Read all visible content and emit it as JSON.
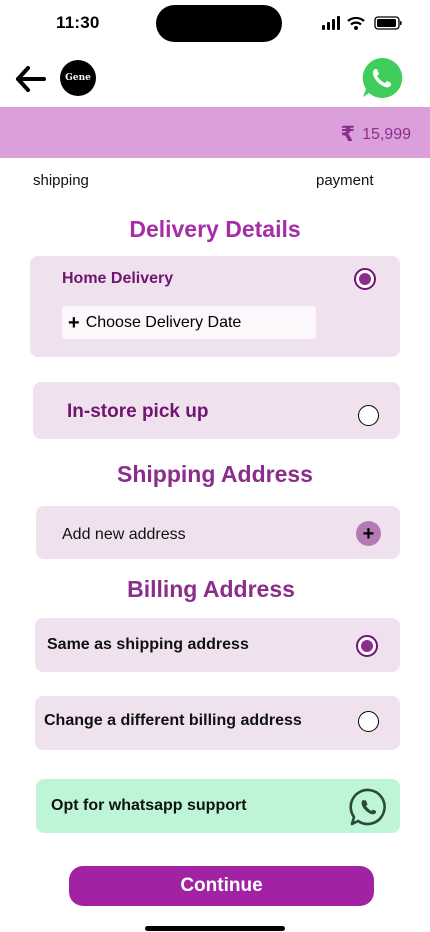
{
  "status_bar": {
    "time": "11:30"
  },
  "header": {
    "logo_text": "Gene"
  },
  "price_bar": {
    "currency_symbol": "₹",
    "amount": "15,999",
    "color": "#dba0dc"
  },
  "steps": {
    "shipping": "shipping",
    "payment": "payment"
  },
  "delivery": {
    "title": "Delivery Details",
    "home_delivery": {
      "label": "Home Delivery",
      "selected": true,
      "date_button": "Choose Delivery Date"
    },
    "in_store": {
      "label": "In-store pick up",
      "selected": false
    }
  },
  "shipping_address": {
    "title": "Shipping Address",
    "add_new": "Add new address"
  },
  "billing_address": {
    "title": "Billing Address",
    "same": {
      "label": "Same as shipping address",
      "selected": true
    },
    "different": {
      "label": "Change a different billing address",
      "selected": false
    }
  },
  "whatsapp_support": {
    "label": "Opt for whatsapp support",
    "color": "#bdf5d6"
  },
  "continue_button": {
    "label": "Continue",
    "color": "#a222a4"
  },
  "icons": [
    "back-arrow-icon",
    "brand-logo-icon",
    "whatsapp-icon",
    "rupee-icon",
    "plus-icon",
    "radio-selected-icon",
    "radio-unselected-icon"
  ]
}
